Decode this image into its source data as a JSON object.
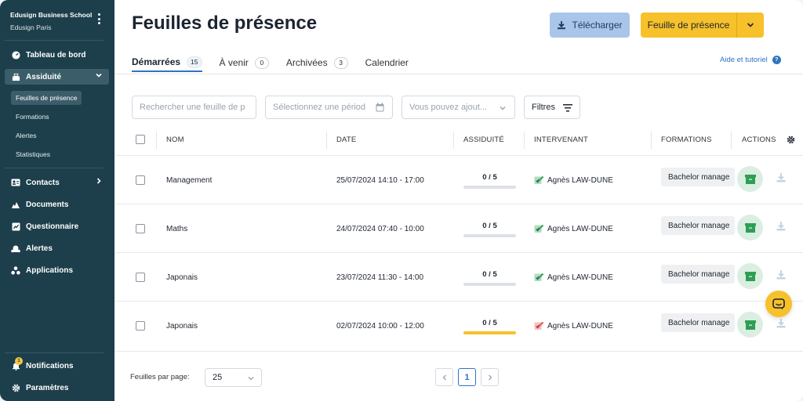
{
  "sidebar": {
    "org_name": "Edusign Business School",
    "org_sub": "Edusign Paris",
    "items": [
      {
        "label": "Tableau de bord",
        "icon": "dashboard-icon"
      },
      {
        "label": "Assiduité",
        "icon": "attendance-icon"
      },
      {
        "label": "Contacts",
        "icon": "contacts-icon"
      },
      {
        "label": "Documents",
        "icon": "documents-icon"
      },
      {
        "label": "Questionnaire",
        "icon": "questionnaire-icon"
      },
      {
        "label": "Alertes",
        "icon": "alerts-icon"
      },
      {
        "label": "Applications",
        "icon": "applications-icon"
      }
    ],
    "subitems": [
      {
        "label": "Feuilles de présence"
      },
      {
        "label": "Formations"
      },
      {
        "label": "Alertes"
      },
      {
        "label": "Statistiques"
      }
    ],
    "bottom": [
      {
        "label": "Notifications",
        "icon": "bell-icon",
        "badge": "1"
      },
      {
        "label": "Paramètres",
        "icon": "gear-icon"
      }
    ]
  },
  "header": {
    "title": "Feuilles de présence",
    "download_label": "Télécharger",
    "new_sheet_label": "Feuille de présence",
    "colors": {
      "download": "#a9c6ea",
      "primary": "#f7c12b",
      "accent": "#2f74c0"
    }
  },
  "tabs": [
    {
      "label": "Démarrées",
      "count": "15"
    },
    {
      "label": "À venir",
      "count": "0"
    },
    {
      "label": "Archivées",
      "count": "3"
    },
    {
      "label": "Calendrier",
      "count": ""
    }
  ],
  "help_label": "Aide et tutoriel",
  "filters": {
    "search_placeholder": "Rechercher une feuille de p",
    "period_placeholder": "Sélectionnez une périod",
    "add_placeholder": "Vous pouvez ajout...",
    "filters_label": "Filtres"
  },
  "table": {
    "headers": [
      "NOM",
      "DATE",
      "ASSIDUITÉ",
      "INTERVENANT",
      "FORMATIONS",
      "ACTIONS"
    ],
    "rows": [
      {
        "name": "Management",
        "date": "25/07/2024 14:10 - 17:00",
        "attendance": "0 / 5",
        "attendance_level": 0,
        "bar": "grey",
        "teacher": "Agnès LAW-DUNE",
        "teacher_status": "green",
        "formation": "Bachelor manage"
      },
      {
        "name": "Maths",
        "date": "24/07/2024 07:40 - 10:00",
        "attendance": "0 / 5",
        "attendance_level": 0,
        "bar": "grey",
        "teacher": "Agnès LAW-DUNE",
        "teacher_status": "green",
        "formation": "Bachelor manage"
      },
      {
        "name": "Japonais",
        "date": "23/07/2024 11:30 - 14:00",
        "attendance": "0 / 5",
        "attendance_level": 0,
        "bar": "grey",
        "teacher": "Agnès LAW-DUNE",
        "teacher_status": "green",
        "formation": "Bachelor manage"
      },
      {
        "name": "Japonais",
        "date": "02/07/2024 10:00 - 12:00",
        "attendance": "0 / 5",
        "attendance_level": 0,
        "bar": "yellow",
        "teacher": "Agnès LAW-DUNE",
        "teacher_status": "red",
        "formation": "Bachelor manage"
      }
    ]
  },
  "footer": {
    "per_page_label": "Feuilles par page:",
    "per_page_value": "25",
    "current_page": "1"
  }
}
